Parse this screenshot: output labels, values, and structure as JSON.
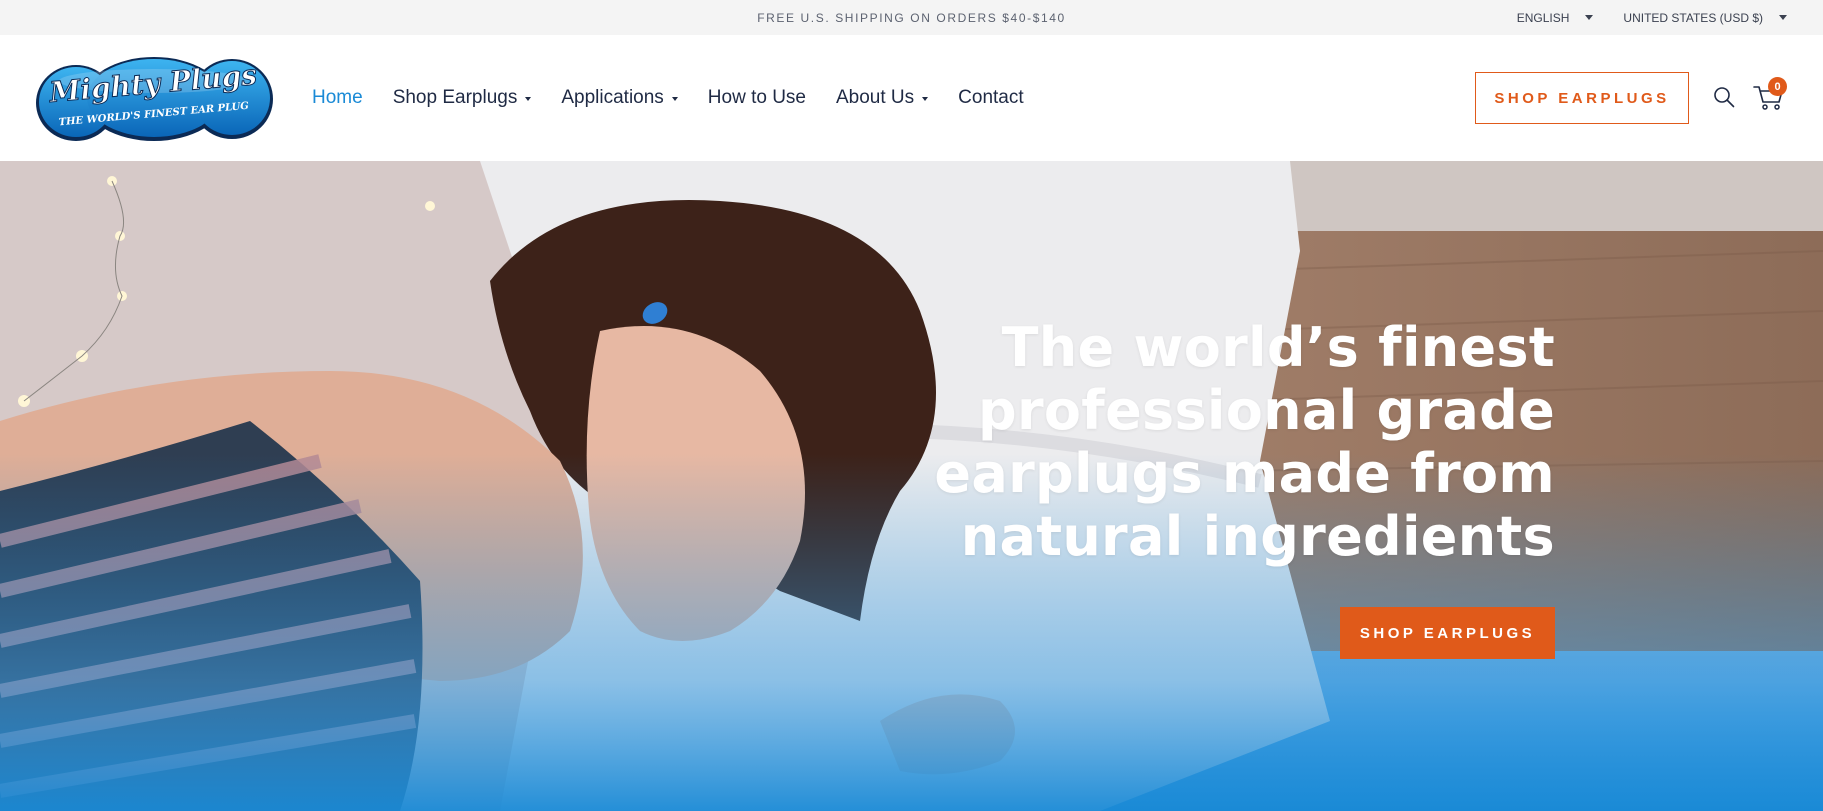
{
  "announcement": "FREE U.S. SHIPPING ON ORDERS $40-$140",
  "selectors": {
    "language": "ENGLISH",
    "currency": "UNITED STATES (USD $)"
  },
  "logo": {
    "line1": "Mighty Plugs",
    "line2": "THE WORLD'S FINEST EAR PLUG"
  },
  "nav": [
    {
      "label": "Home",
      "active": true,
      "dropdown": false
    },
    {
      "label": "Shop Earplugs",
      "active": false,
      "dropdown": true
    },
    {
      "label": "Applications",
      "active": false,
      "dropdown": true
    },
    {
      "label": "How to Use",
      "active": false,
      "dropdown": false
    },
    {
      "label": "About Us",
      "active": false,
      "dropdown": true
    },
    {
      "label": "Contact",
      "active": false,
      "dropdown": false
    }
  ],
  "header": {
    "cta_label": "SHOP EARPLUGS",
    "cart_count": "0"
  },
  "hero": {
    "title": "The world’s finest professional grade earplugs made from natural ingredients",
    "cta_label": "SHOP EARPLUGS"
  },
  "colors": {
    "accent": "#e05a1a",
    "brand_blue": "#1a8ad6",
    "nav_text": "#1f2a44"
  },
  "icons": [
    "search-icon",
    "cart-icon",
    "chevron-down-icon"
  ]
}
